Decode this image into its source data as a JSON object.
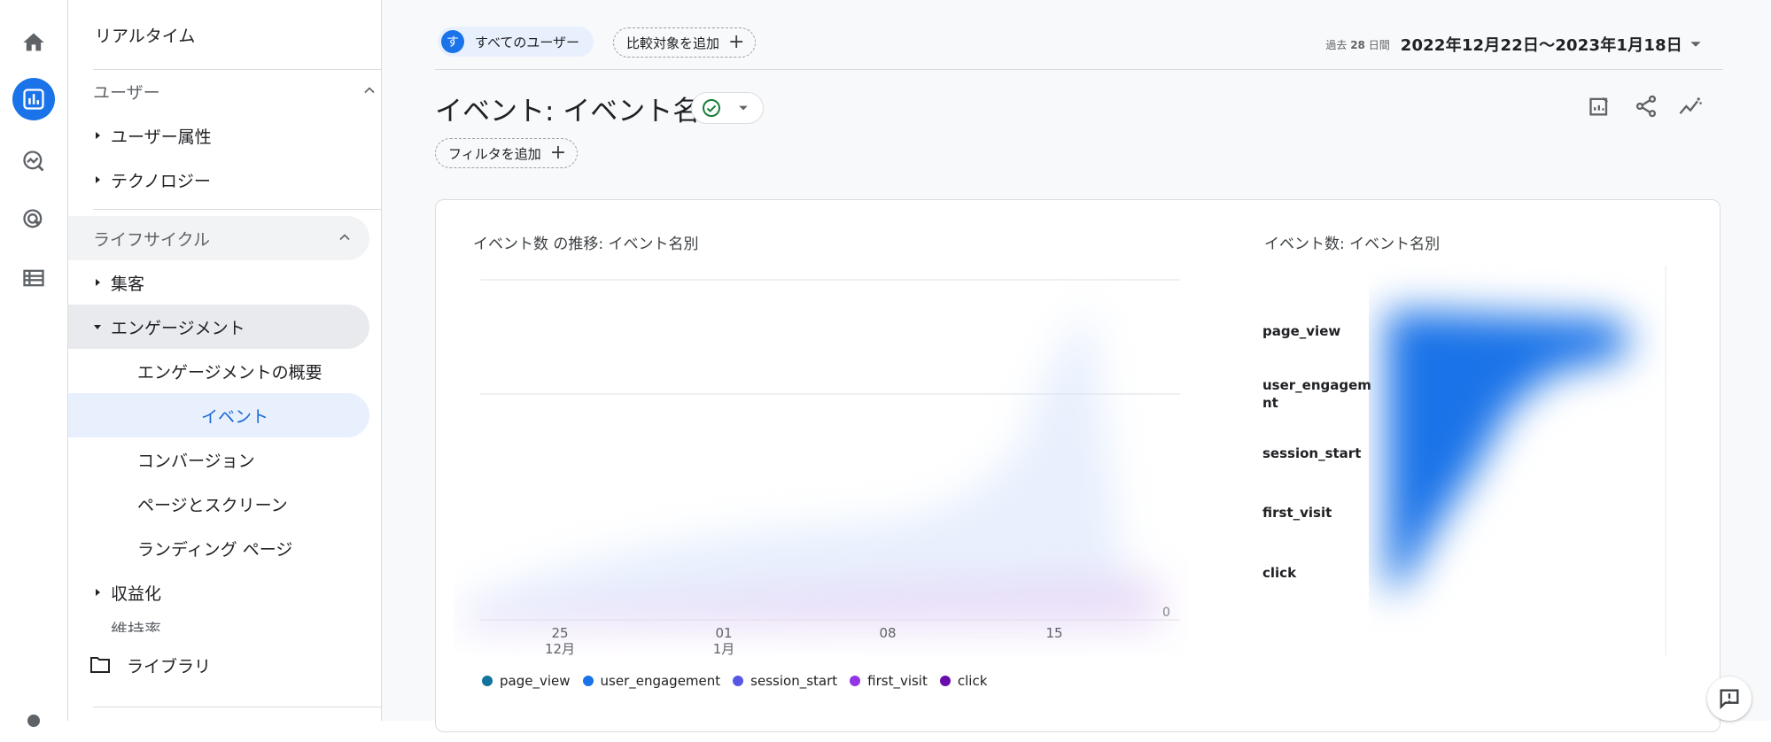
{
  "rail": {
    "icons": [
      "home-icon",
      "reports-icon",
      "explore-icon",
      "advertising-icon",
      "configure-icon",
      "admin-gear-icon"
    ],
    "active": "reports-icon"
  },
  "nav": {
    "realtime": "リアルタイム",
    "users_section": "ユーザー",
    "user_attributes": "ユーザー属性",
    "technology": "テクノロジー",
    "lifecycle_section": "ライフサイクル",
    "acquisition": "集客",
    "engagement": "エンゲージメント",
    "engagement_overview": "エンゲージメントの概要",
    "events": "イベント",
    "conversions": "コンバージョン",
    "pages_screens": "ページとスクリーン",
    "landing_page": "ランディング ページ",
    "monetization": "収益化",
    "retention": "維持率",
    "library": "ライブラリ"
  },
  "header": {
    "segment_badge": "す",
    "segment_label": "すべてのユーザー",
    "add_comparison": "比較対象を追加",
    "date_relative_prefix": "過去",
    "date_relative_days": "28",
    "date_relative_suffix": "日間",
    "date_range": "2022年12月22日～2023年1月18日"
  },
  "page": {
    "title": "イベント: イベント名",
    "add_filter": "フィルタを追加"
  },
  "card": {
    "line_title": "イベント数 の推移: イベント名別",
    "bar_title": "イベント数: イベント名別"
  },
  "chart_data": [
    {
      "type": "line",
      "title": "イベント数 の推移: イベント名別",
      "x_ticks": [
        {
          "day": "25",
          "month": "12月"
        },
        {
          "day": "01",
          "month": "1月"
        },
        {
          "day": "08",
          "month": ""
        },
        {
          "day": "15",
          "month": ""
        }
      ],
      "y_ticks": [
        "0"
      ],
      "series": [
        {
          "name": "page_view",
          "color": "#12739e"
        },
        {
          "name": "user_engagement",
          "color": "#1a73e8"
        },
        {
          "name": "session_start",
          "color": "#5757e6"
        },
        {
          "name": "first_visit",
          "color": "#9334e6"
        },
        {
          "name": "click",
          "color": "#6a0dad"
        }
      ],
      "legend": "bottom"
    },
    {
      "type": "bar",
      "title": "イベント数: イベント名別",
      "categories": [
        "page_view",
        "user_engagement",
        "session_start",
        "first_visit",
        "click"
      ],
      "category_display": [
        "page_view",
        "user_engagem\nnt",
        "session_start",
        "first_visit",
        "click"
      ],
      "color": "#1a73e8"
    }
  ]
}
